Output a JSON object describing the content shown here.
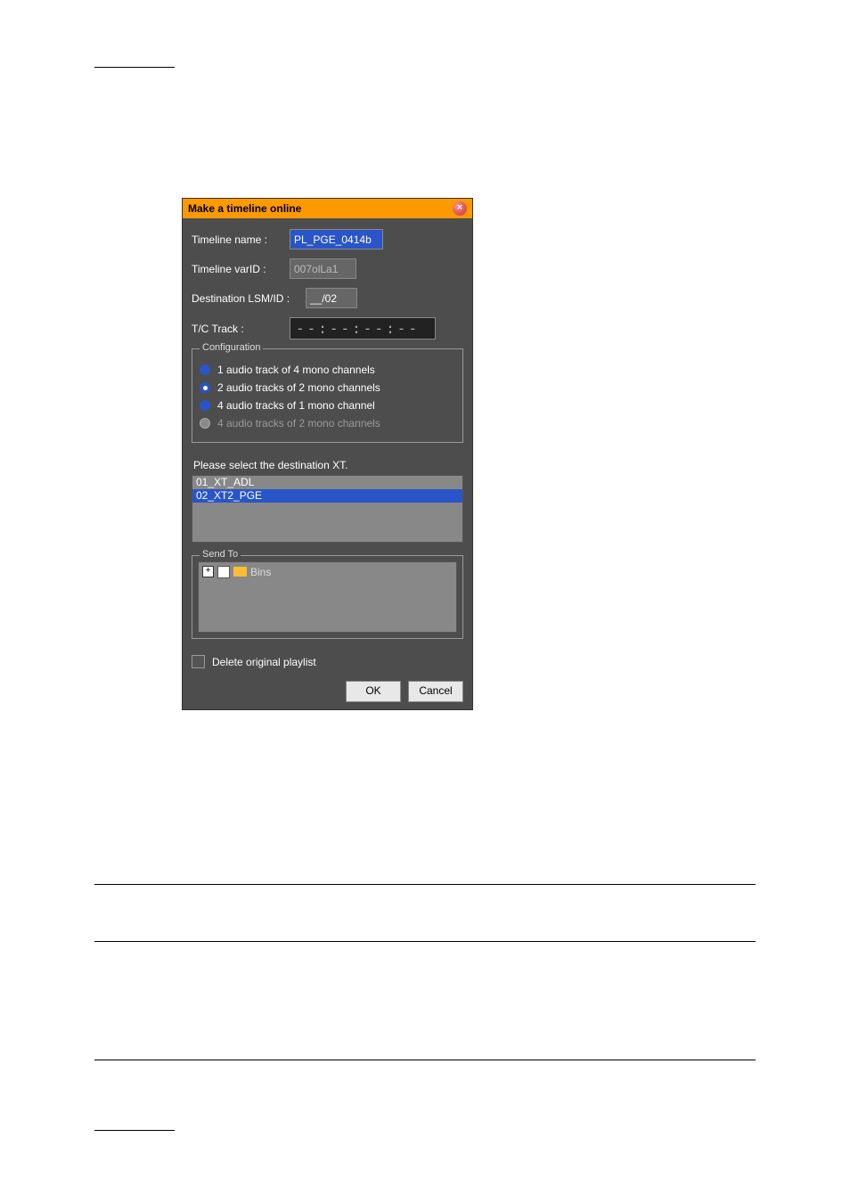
{
  "dialog": {
    "title": "Make a timeline online",
    "fields": {
      "timeline_name": {
        "label": "Timeline name :",
        "value": "PL_PGE_0414b"
      },
      "timeline_varid": {
        "label": "Timeline varID :",
        "value": "007olLa1"
      },
      "destination_lsmid": {
        "label": "Destination LSM/ID :",
        "value": "__/02"
      },
      "tc_track": {
        "label": "T/C Track :",
        "value": "--:--:--:--"
      }
    },
    "configuration": {
      "legend": "Configuration",
      "options": [
        {
          "label": "1 audio track of 4 mono channels",
          "selected": false,
          "enabled": true
        },
        {
          "label": "2 audio tracks of 2 mono channels",
          "selected": true,
          "enabled": true
        },
        {
          "label": "4 audio tracks of 1 mono channel",
          "selected": false,
          "enabled": true
        },
        {
          "label": "4 audio tracks of 2 mono channels",
          "selected": false,
          "enabled": false
        }
      ]
    },
    "destination": {
      "instruction": "Please select the destination XT.",
      "items": [
        {
          "label": "01_XT_ADL",
          "selected": false
        },
        {
          "label": "02_XT2_PGE",
          "selected": true
        }
      ]
    },
    "send_to": {
      "legend": "Send To",
      "root_label": "Bins"
    },
    "delete_original": {
      "label": "Delete original playlist",
      "checked": false
    },
    "buttons": {
      "ok": "OK",
      "cancel": "Cancel"
    }
  }
}
